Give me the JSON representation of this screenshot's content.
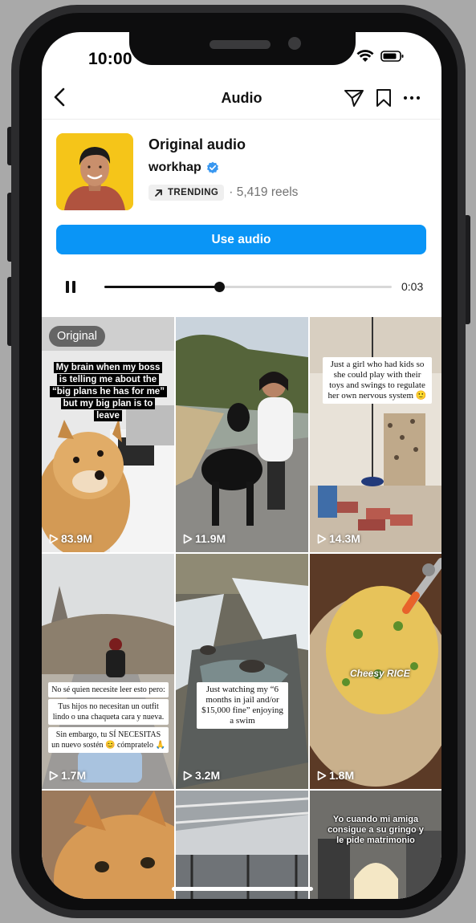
{
  "status_bar": {
    "time": "10:00"
  },
  "header": {
    "title": "Audio"
  },
  "audio": {
    "title": "Original audio",
    "artist": "workhap",
    "badge": "TRENDING",
    "reels": "· 5,419 reels",
    "use_button": "Use audio",
    "progress": 0.4,
    "duration": "0:03"
  },
  "colors": {
    "accent": "#0a95f6",
    "verified": "#3897f0",
    "cover_bg": "#f5c519"
  },
  "tiles": [
    {
      "views": "83.9M",
      "badge": "Original",
      "caption": "My brain when my boss is telling me about the “big plans he has for me” but my big plan is to leave"
    },
    {
      "views": "11.9M"
    },
    {
      "views": "14.3M",
      "caption": "Just a girl who had kids so she could play with their toys and swings to regulate her own nervous system 🙂"
    },
    {
      "views": "1.7M",
      "captions": [
        "No sé quien necesite leer esto pero:",
        "Tus hijos no necesitan un outfit lindo o una chaqueta cara y nueva.",
        "Sin embargo, tu SÍ NECESITAS un nuevo sostén 😊 cómpratelo 🙏"
      ]
    },
    {
      "views": "3.2M",
      "caption": "Just watching my “6 months in jail and/or $15,000 fine” enjoying a swim"
    },
    {
      "views": "1.8M",
      "caption": "Cheesy RICE"
    },
    {},
    {},
    {
      "caption": "Yo cuando mi amiga consigue a su gringo y le pide matrimonio"
    }
  ]
}
